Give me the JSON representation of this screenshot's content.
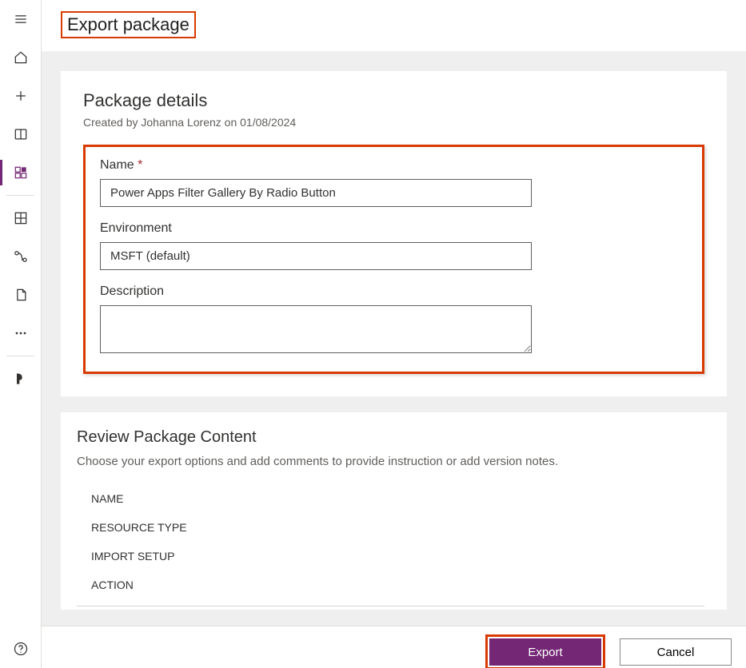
{
  "page_title": "Export package",
  "details": {
    "section_title": "Package details",
    "created_by": "Created by Johanna Lorenz on 01/08/2024",
    "name_label": "Name",
    "name_value": "Power Apps Filter Gallery By Radio Button",
    "env_label": "Environment",
    "env_value": "MSFT (default)",
    "desc_label": "Description",
    "desc_value": ""
  },
  "review": {
    "title": "Review Package Content",
    "desc": "Choose your export options and add comments to provide instruction or add version notes.",
    "rows": {
      "name": "NAME",
      "resource_type": "RESOURCE TYPE",
      "import_setup": "IMPORT SETUP",
      "action": "ACTION"
    }
  },
  "footer": {
    "export": "Export",
    "cancel": "Cancel"
  }
}
